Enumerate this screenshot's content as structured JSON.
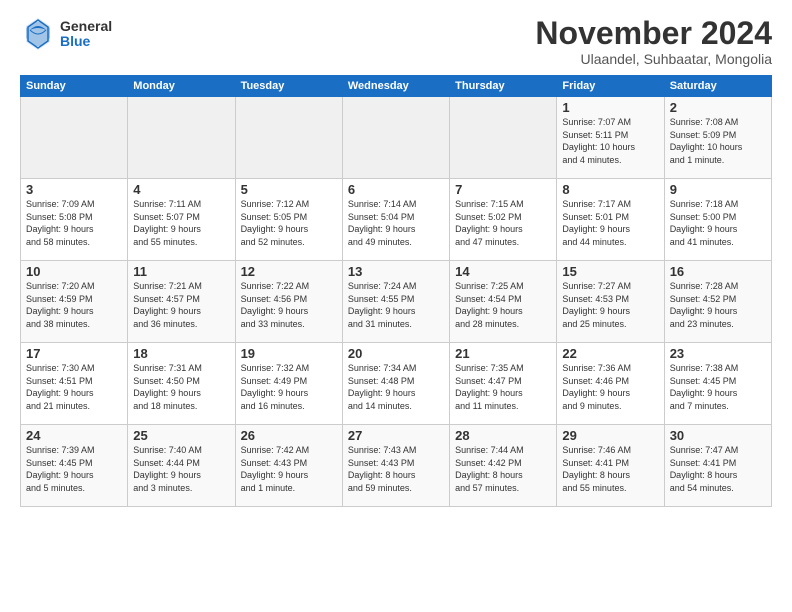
{
  "logo": {
    "general": "General",
    "blue": "Blue"
  },
  "title": "November 2024",
  "subtitle": "Ulaandel, Suhbaatar, Mongolia",
  "headers": [
    "Sunday",
    "Monday",
    "Tuesday",
    "Wednesday",
    "Thursday",
    "Friday",
    "Saturday"
  ],
  "weeks": [
    [
      {
        "day": "",
        "info": ""
      },
      {
        "day": "",
        "info": ""
      },
      {
        "day": "",
        "info": ""
      },
      {
        "day": "",
        "info": ""
      },
      {
        "day": "",
        "info": ""
      },
      {
        "day": "1",
        "info": "Sunrise: 7:07 AM\nSunset: 5:11 PM\nDaylight: 10 hours\nand 4 minutes."
      },
      {
        "day": "2",
        "info": "Sunrise: 7:08 AM\nSunset: 5:09 PM\nDaylight: 10 hours\nand 1 minute."
      }
    ],
    [
      {
        "day": "3",
        "info": "Sunrise: 7:09 AM\nSunset: 5:08 PM\nDaylight: 9 hours\nand 58 minutes."
      },
      {
        "day": "4",
        "info": "Sunrise: 7:11 AM\nSunset: 5:07 PM\nDaylight: 9 hours\nand 55 minutes."
      },
      {
        "day": "5",
        "info": "Sunrise: 7:12 AM\nSunset: 5:05 PM\nDaylight: 9 hours\nand 52 minutes."
      },
      {
        "day": "6",
        "info": "Sunrise: 7:14 AM\nSunset: 5:04 PM\nDaylight: 9 hours\nand 49 minutes."
      },
      {
        "day": "7",
        "info": "Sunrise: 7:15 AM\nSunset: 5:02 PM\nDaylight: 9 hours\nand 47 minutes."
      },
      {
        "day": "8",
        "info": "Sunrise: 7:17 AM\nSunset: 5:01 PM\nDaylight: 9 hours\nand 44 minutes."
      },
      {
        "day": "9",
        "info": "Sunrise: 7:18 AM\nSunset: 5:00 PM\nDaylight: 9 hours\nand 41 minutes."
      }
    ],
    [
      {
        "day": "10",
        "info": "Sunrise: 7:20 AM\nSunset: 4:59 PM\nDaylight: 9 hours\nand 38 minutes."
      },
      {
        "day": "11",
        "info": "Sunrise: 7:21 AM\nSunset: 4:57 PM\nDaylight: 9 hours\nand 36 minutes."
      },
      {
        "day": "12",
        "info": "Sunrise: 7:22 AM\nSunset: 4:56 PM\nDaylight: 9 hours\nand 33 minutes."
      },
      {
        "day": "13",
        "info": "Sunrise: 7:24 AM\nSunset: 4:55 PM\nDaylight: 9 hours\nand 31 minutes."
      },
      {
        "day": "14",
        "info": "Sunrise: 7:25 AM\nSunset: 4:54 PM\nDaylight: 9 hours\nand 28 minutes."
      },
      {
        "day": "15",
        "info": "Sunrise: 7:27 AM\nSunset: 4:53 PM\nDaylight: 9 hours\nand 25 minutes."
      },
      {
        "day": "16",
        "info": "Sunrise: 7:28 AM\nSunset: 4:52 PM\nDaylight: 9 hours\nand 23 minutes."
      }
    ],
    [
      {
        "day": "17",
        "info": "Sunrise: 7:30 AM\nSunset: 4:51 PM\nDaylight: 9 hours\nand 21 minutes."
      },
      {
        "day": "18",
        "info": "Sunrise: 7:31 AM\nSunset: 4:50 PM\nDaylight: 9 hours\nand 18 minutes."
      },
      {
        "day": "19",
        "info": "Sunrise: 7:32 AM\nSunset: 4:49 PM\nDaylight: 9 hours\nand 16 minutes."
      },
      {
        "day": "20",
        "info": "Sunrise: 7:34 AM\nSunset: 4:48 PM\nDaylight: 9 hours\nand 14 minutes."
      },
      {
        "day": "21",
        "info": "Sunrise: 7:35 AM\nSunset: 4:47 PM\nDaylight: 9 hours\nand 11 minutes."
      },
      {
        "day": "22",
        "info": "Sunrise: 7:36 AM\nSunset: 4:46 PM\nDaylight: 9 hours\nand 9 minutes."
      },
      {
        "day": "23",
        "info": "Sunrise: 7:38 AM\nSunset: 4:45 PM\nDaylight: 9 hours\nand 7 minutes."
      }
    ],
    [
      {
        "day": "24",
        "info": "Sunrise: 7:39 AM\nSunset: 4:45 PM\nDaylight: 9 hours\nand 5 minutes."
      },
      {
        "day": "25",
        "info": "Sunrise: 7:40 AM\nSunset: 4:44 PM\nDaylight: 9 hours\nand 3 minutes."
      },
      {
        "day": "26",
        "info": "Sunrise: 7:42 AM\nSunset: 4:43 PM\nDaylight: 9 hours\nand 1 minute."
      },
      {
        "day": "27",
        "info": "Sunrise: 7:43 AM\nSunset: 4:43 PM\nDaylight: 8 hours\nand 59 minutes."
      },
      {
        "day": "28",
        "info": "Sunrise: 7:44 AM\nSunset: 4:42 PM\nDaylight: 8 hours\nand 57 minutes."
      },
      {
        "day": "29",
        "info": "Sunrise: 7:46 AM\nSunset: 4:41 PM\nDaylight: 8 hours\nand 55 minutes."
      },
      {
        "day": "30",
        "info": "Sunrise: 7:47 AM\nSunset: 4:41 PM\nDaylight: 8 hours\nand 54 minutes."
      }
    ]
  ]
}
